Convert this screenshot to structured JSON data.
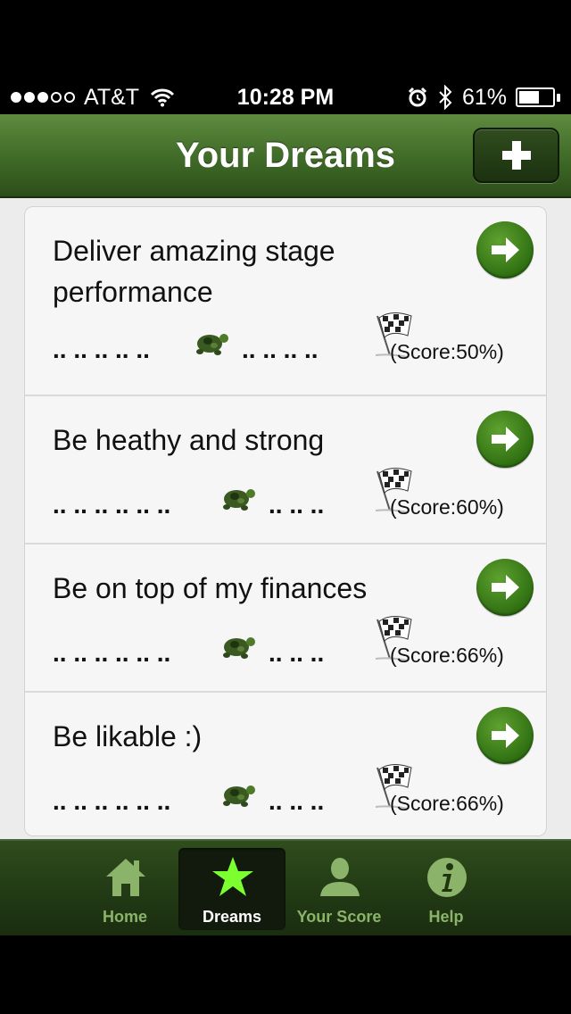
{
  "status_bar": {
    "carrier": "AT&T",
    "time": "10:28 PM",
    "battery_percent": "61%",
    "battery_level": 0.61,
    "signal_bars_filled": 3,
    "signal_bars_total": 5,
    "icons": [
      "wifi-icon",
      "alarm-icon",
      "bluetooth-icon",
      "battery-icon"
    ]
  },
  "nav": {
    "title": "Your Dreams",
    "add_icon": "plus-icon"
  },
  "dreams": [
    {
      "title": "Deliver amazing stage performance",
      "dots_before": ".. .. .. .. ..",
      "dots_after": ".. .. .. ..",
      "score_label": "(Score:50%)",
      "score": 50
    },
    {
      "title": "Be heathy and strong",
      "dots_before": ".. .. .. .. .. ..",
      "dots_after": ".. .. ..",
      "score_label": "(Score:60%)",
      "score": 60
    },
    {
      "title": "Be on top of my finances",
      "dots_before": ".. .. .. .. .. ..",
      "dots_after": ".. .. ..",
      "score_label": "(Score:66%)",
      "score": 66
    },
    {
      "title": "Be likable :)",
      "dots_before": ".. .. .. .. .. ..",
      "dots_after": ".. .. ..",
      "score_label": "(Score:66%)",
      "score": 66
    }
  ],
  "tabs": [
    {
      "label": "Home",
      "icon": "home-icon",
      "active": false
    },
    {
      "label": "Dreams",
      "icon": "star-icon",
      "active": true
    },
    {
      "label": "Your Score",
      "icon": "person-icon",
      "active": false
    },
    {
      "label": "Help",
      "icon": "info-icon",
      "active": false
    }
  ],
  "colors": {
    "nav_green": "#3f6a27",
    "arrow_green": "#2f6f12",
    "tab_inactive": "#8bb46a",
    "star_active": "#7cff2e"
  }
}
